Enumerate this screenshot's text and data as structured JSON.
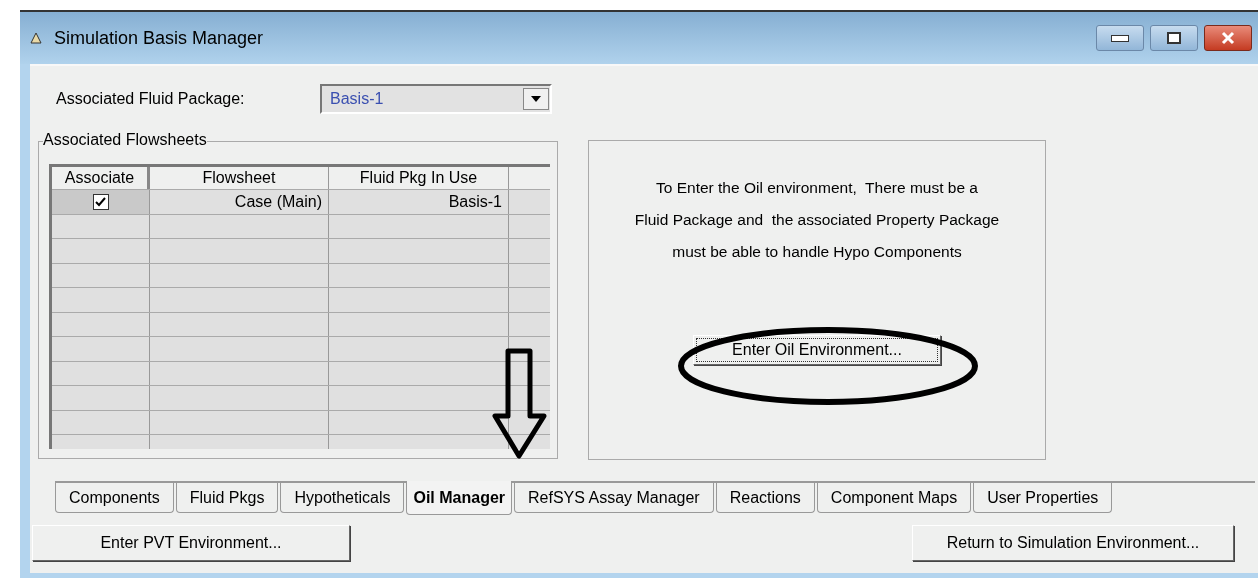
{
  "window": {
    "title": "Simulation Basis Manager"
  },
  "fluid_package": {
    "label": "Associated Fluid Package:",
    "value": "Basis-1"
  },
  "flowsheets": {
    "title": "Associated Flowsheets",
    "columns": [
      "Associate",
      "Flowsheet",
      "Fluid Pkg In Use"
    ],
    "rows": [
      {
        "associate": true,
        "flowsheet": "Case (Main)",
        "fluid_pkg": "Basis-1"
      }
    ]
  },
  "oil_info": {
    "message_lines": [
      "To Enter the Oil environment,  There must be a",
      "Fluid Package and  the associated Property Package",
      "must be able to handle Hypo Components"
    ],
    "button": "Enter Oil Environment..."
  },
  "tabs": [
    {
      "label": "Components",
      "selected": false
    },
    {
      "label": "Fluid Pkgs",
      "selected": false
    },
    {
      "label": "Hypotheticals",
      "selected": false
    },
    {
      "label": "Oil Manager",
      "selected": true
    },
    {
      "label": "RefSYS Assay Manager",
      "selected": false
    },
    {
      "label": "Reactions",
      "selected": false
    },
    {
      "label": "Component Maps",
      "selected": false
    },
    {
      "label": "User Properties",
      "selected": false
    }
  ],
  "buttons": [
    {
      "label": "Enter PVT Environment..."
    },
    {
      "label": "Return to Simulation Environment..."
    }
  ]
}
